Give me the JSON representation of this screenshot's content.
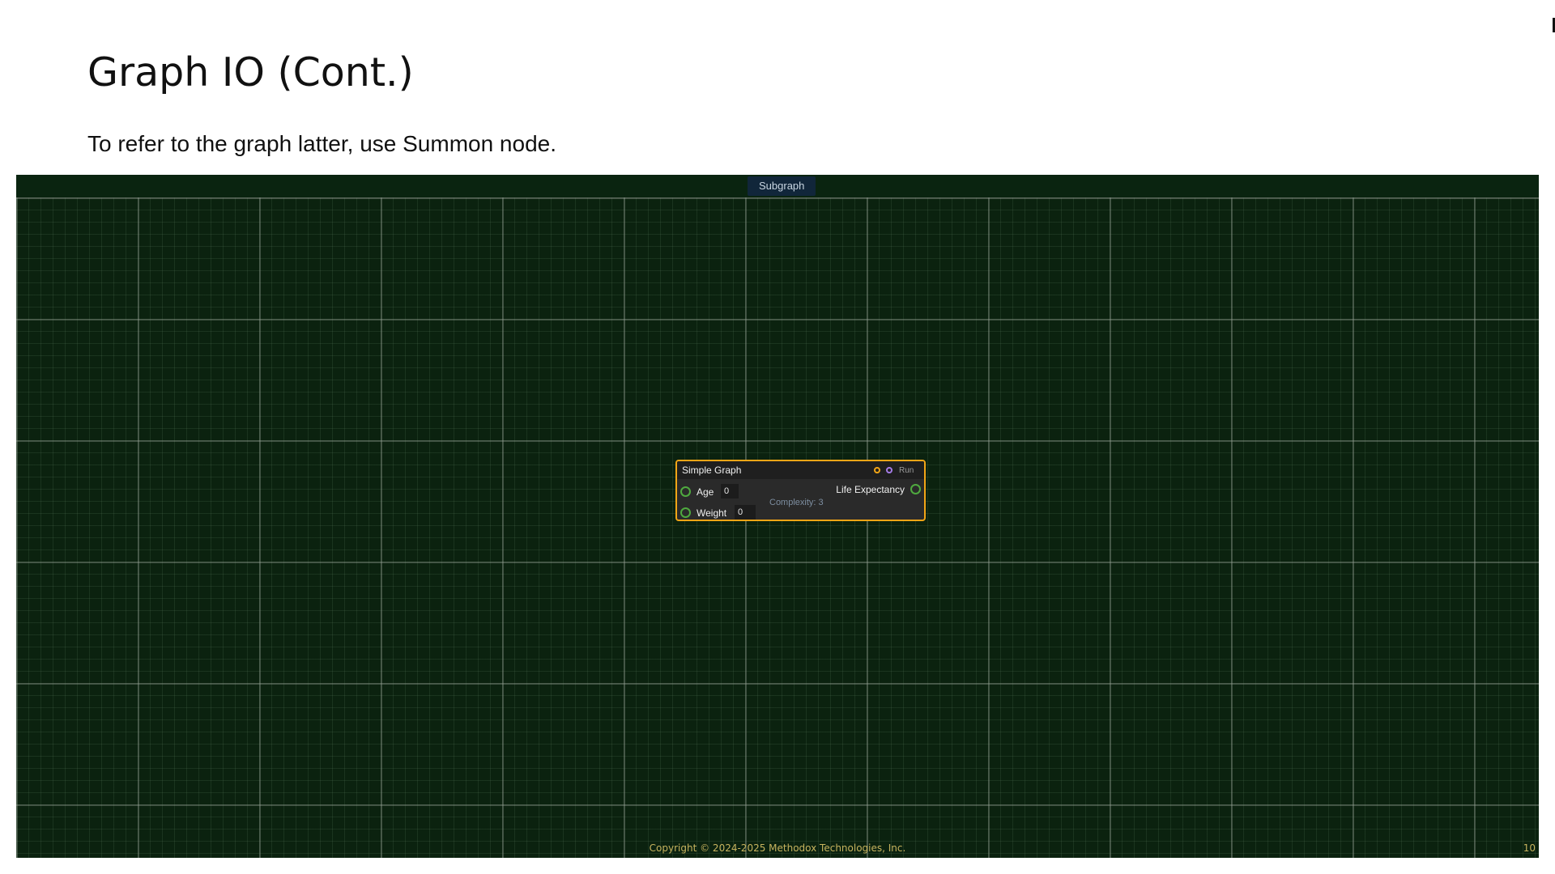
{
  "slide": {
    "title": "Graph IO (Cont.)",
    "text": "To refer to the graph latter, use Summon node."
  },
  "canvas": {
    "tab_label": "Subgraph",
    "background_color": "#0b220f",
    "node": {
      "title": "Simple Graph",
      "run_label": "Run",
      "inputs": [
        {
          "label": "Age",
          "value": "0"
        },
        {
          "label": "Weight",
          "value": "0"
        }
      ],
      "output_label": "Life Expectancy",
      "complexity": "Complexity: 3",
      "border_color": "#f2a516",
      "exec_in_icon": "exec-in-pin-icon",
      "exec_out_icon": "exec-out-pin-icon",
      "data_pin_color": "#4fa93f"
    }
  },
  "footer": {
    "copyright": "Copyright © 2024-2025 Methodox Technologies, Inc.",
    "page_number": "10"
  }
}
